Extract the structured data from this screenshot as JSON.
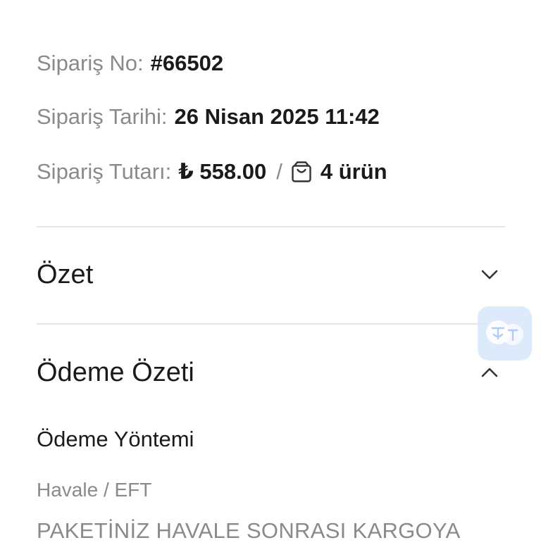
{
  "order": {
    "number_label": "Sipariş No:",
    "number_value": "#66502",
    "date_label": "Sipariş Tarihi:",
    "date_value": "26 Nisan 2025 11:42",
    "total_label": "Sipariş Tutarı:",
    "total_value": "₺ 558.00",
    "separator": "/",
    "item_count": "4 ürün"
  },
  "sections": {
    "summary_title": "Özet",
    "payment_title": "Ödeme Özeti"
  },
  "payment": {
    "method_label": "Ödeme Yöntemi",
    "method_value": "Havale / EFT",
    "note": "PAKETİNİZ HAVALE SONRASI KARGOYA"
  },
  "icons": {
    "bag": "shopping-bag-icon",
    "summary_chevron": "chevron-down-icon",
    "payment_chevron": "chevron-up-icon",
    "translate": "translate-icon"
  },
  "colors": {
    "text": "#1a1a1a",
    "muted": "#8a8a8a",
    "divider": "#e6e6e6",
    "widget": "#d9e8fb"
  }
}
